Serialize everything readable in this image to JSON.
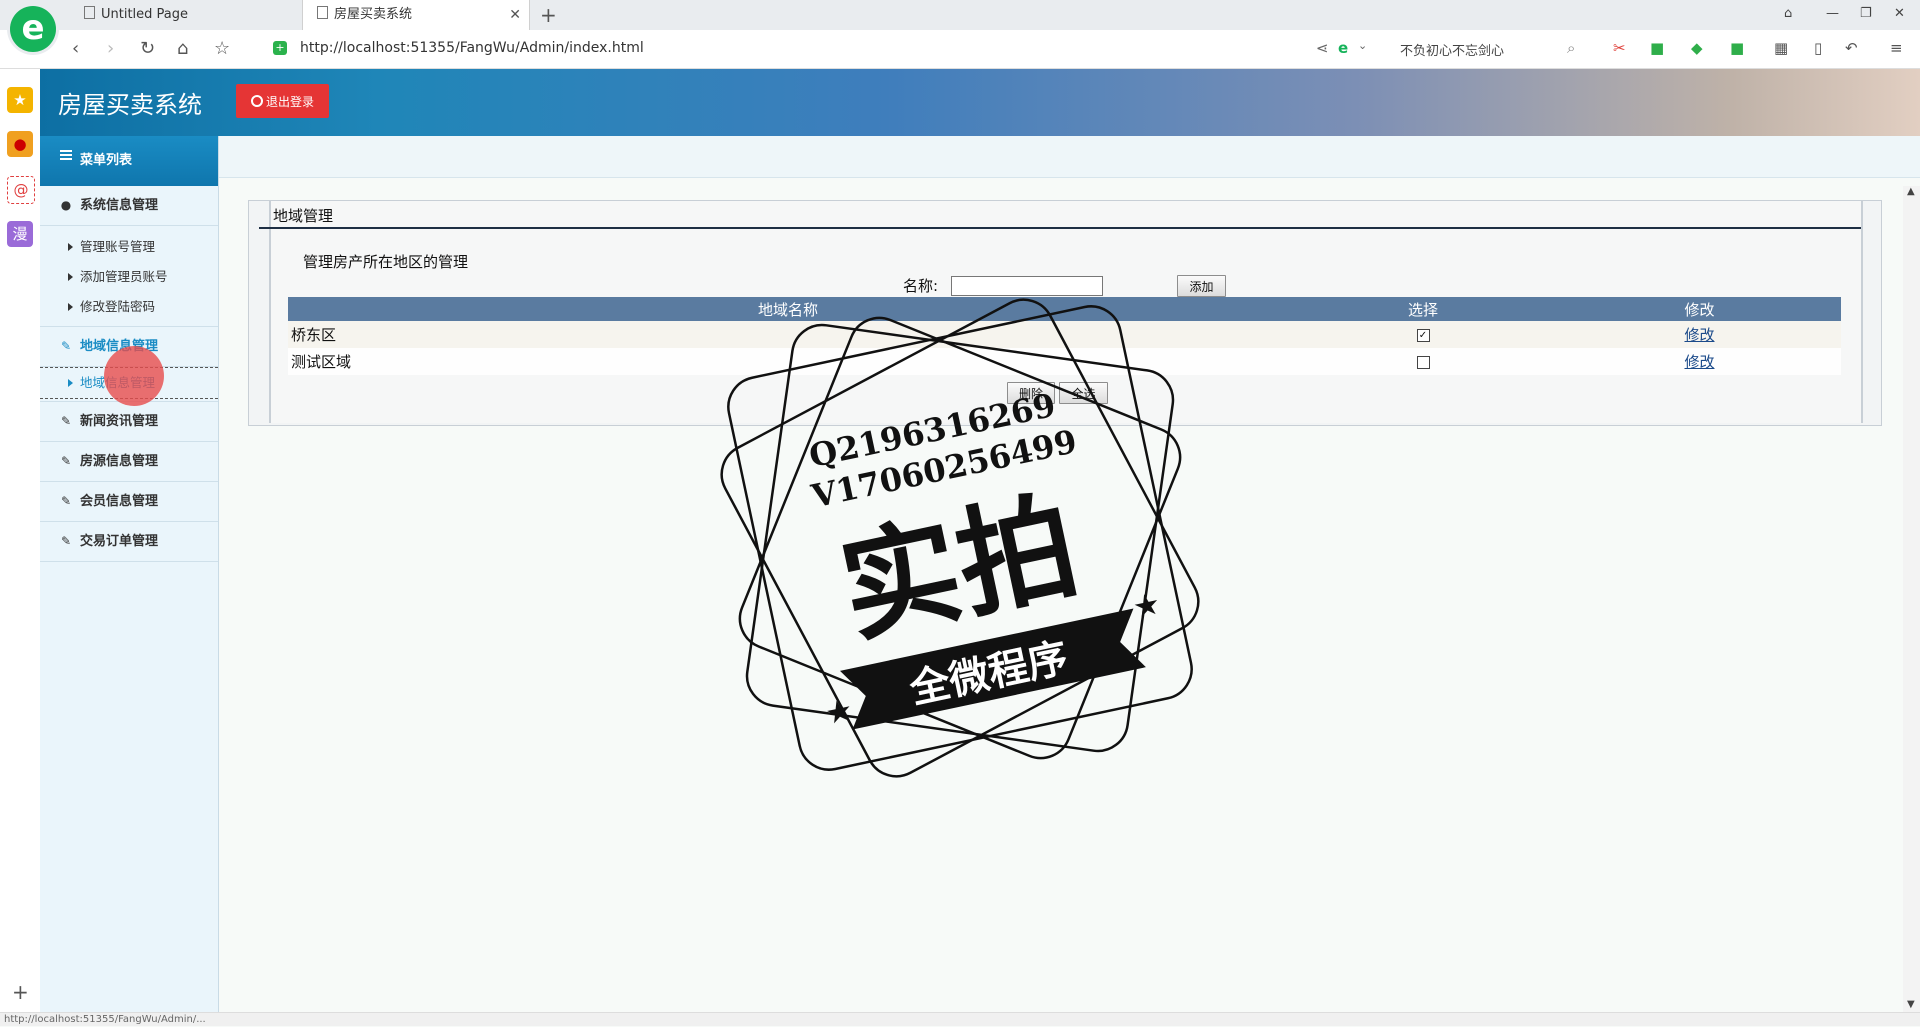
{
  "browser": {
    "logo_glyph": "e",
    "tabs": [
      {
        "label": "Untitled Page"
      },
      {
        "label": "房屋买卖系统"
      }
    ],
    "url": "http://localhost:51355/FangWu/Admin/index.html",
    "search_text": "不负初心不忘剑心",
    "new_tab": "+",
    "close_tab": "✕"
  },
  "app": {
    "title": "房屋买卖系统",
    "logout_label": "退出登录"
  },
  "sidebar": {
    "header": "菜单列表",
    "groups": [
      {
        "label": "系统信息管理",
        "items": [
          {
            "label": "管理账号管理"
          },
          {
            "label": "添加管理员账号"
          },
          {
            "label": "修改登陆密码"
          }
        ]
      },
      {
        "label": "地域信息管理",
        "items": [
          {
            "label": "地域信息管理"
          }
        ]
      },
      {
        "label": "新闻资讯管理"
      },
      {
        "label": "房源信息管理"
      },
      {
        "label": "会员信息管理"
      },
      {
        "label": "交易订单管理"
      }
    ]
  },
  "main": {
    "panel_title": "地域管理",
    "description": "管理房产所在地区的管理",
    "name_label": "名称:",
    "name_value": "",
    "add_label": "添加",
    "table": {
      "headers": [
        "地域名称",
        "选择",
        "修改"
      ],
      "rows": [
        {
          "name": "桥东区",
          "checked": true,
          "edit": "修改"
        },
        {
          "name": "测试区域",
          "checked": false,
          "edit": "修改"
        }
      ]
    },
    "delete_label": "删除",
    "select_all_label": "全选"
  },
  "watermark": {
    "line1": "Q2196316269",
    "line2": "V17060256499",
    "big": "实拍",
    "ribbon": "全微程序"
  },
  "status": {
    "url_hint": "http://localhost:51355/FangWu/Admin/..."
  },
  "colors": {
    "accent": "#1a8cc4",
    "logout": "#e53535",
    "table_header": "#5a7ba0"
  }
}
